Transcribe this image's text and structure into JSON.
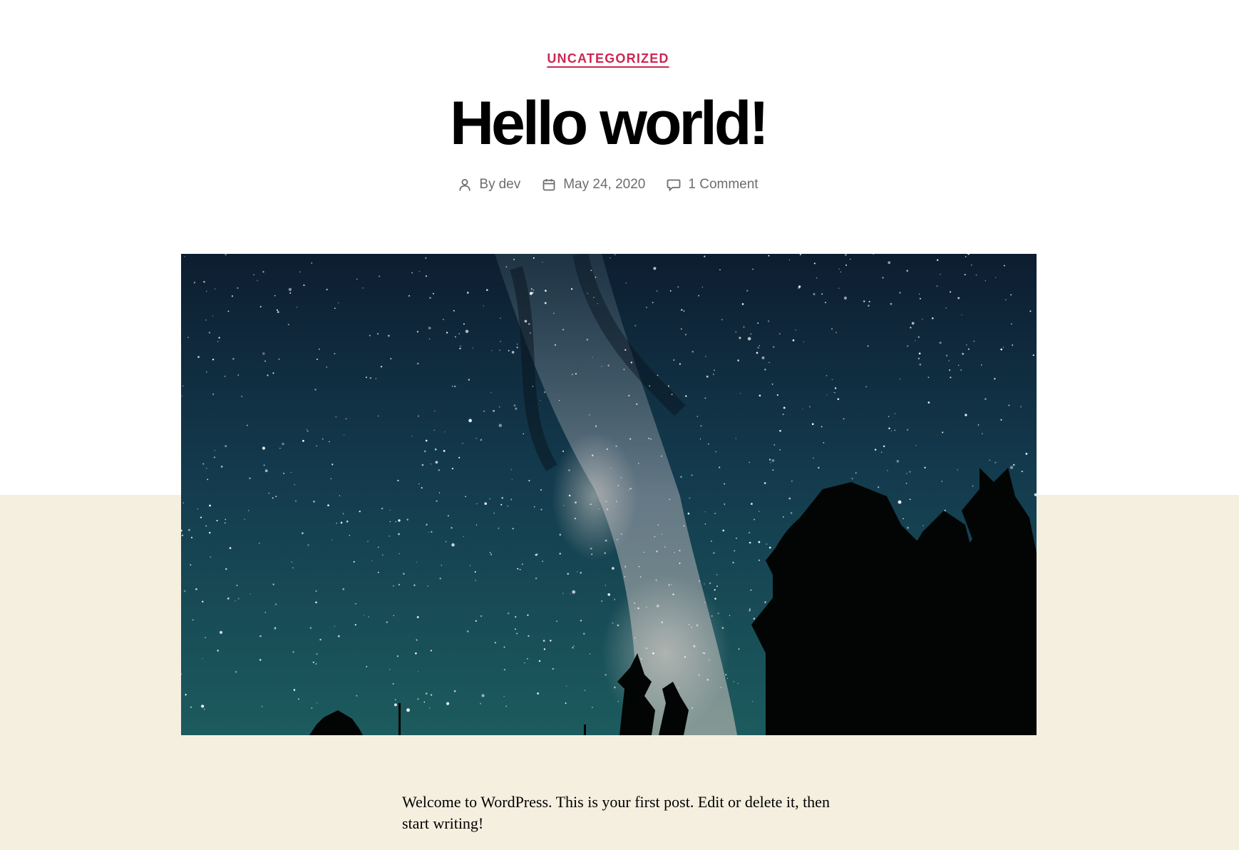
{
  "post": {
    "category": "UNCATEGORIZED",
    "title": "Hello world!",
    "meta": {
      "author_prefix": "By",
      "author": "dev",
      "date": "May 24, 2020",
      "comments": "1 Comment"
    },
    "featured_image": {
      "alt": "Starry night sky with the Milky Way above silhouetted trees"
    },
    "content": "Welcome to WordPress. This is your first post. Edit or delete it, then start writing!"
  },
  "colors": {
    "accent": "#cd2653",
    "meta_text": "#6d6d6d",
    "background_top": "#ffffff",
    "background_bottom": "#f5efe0"
  }
}
